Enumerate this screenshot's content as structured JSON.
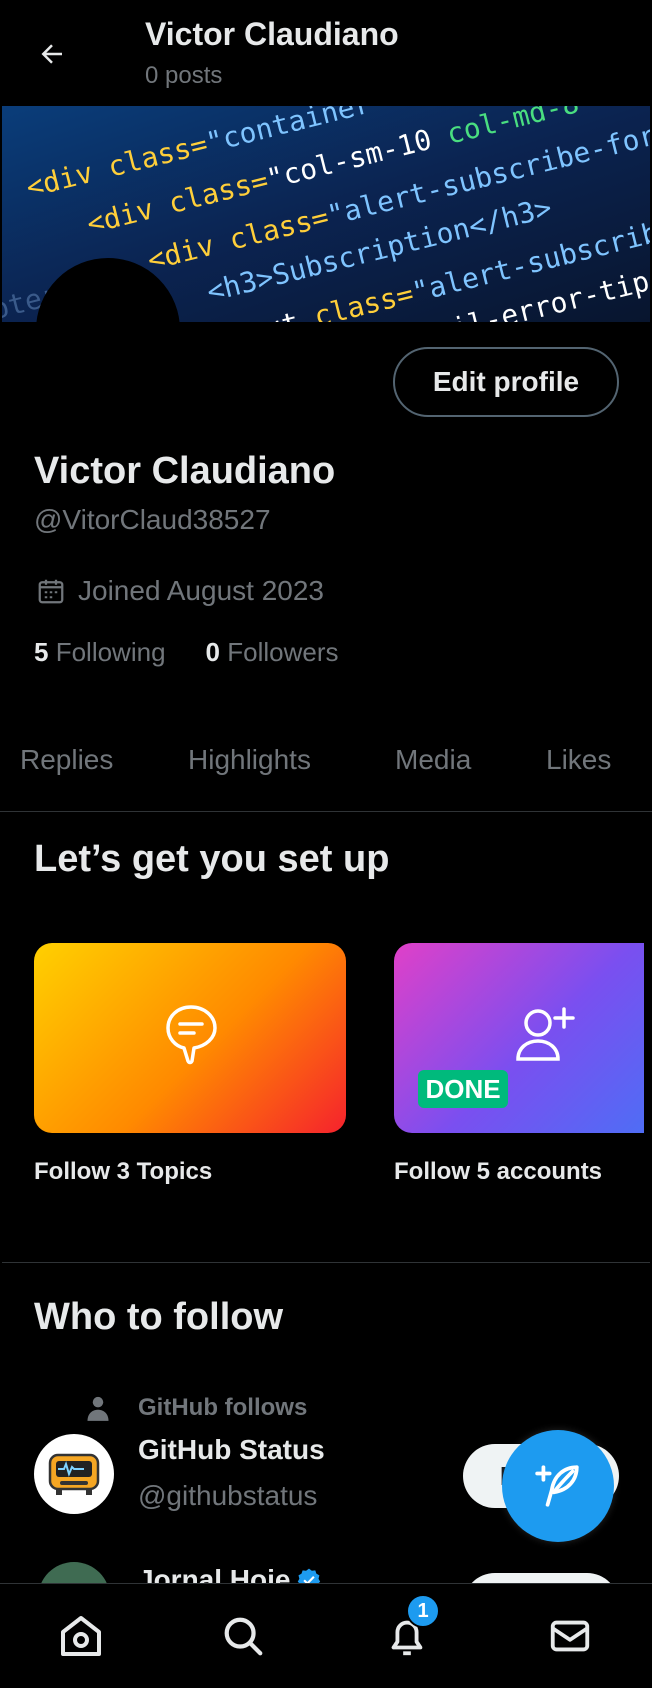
{
  "header": {
    "title": "Victor Claudiano",
    "post_count": "0 posts"
  },
  "profile": {
    "edit_button": "Edit profile",
    "display_name": "Victor Claudiano",
    "handle": "@VitorClaud38527",
    "joined": "Joined August 2023",
    "following_count": "5",
    "following_label": "Following",
    "followers_count": "0",
    "followers_label": "Followers"
  },
  "tabs": [
    "Replies",
    "Highlights",
    "Media",
    "Likes"
  ],
  "setup": {
    "title": "Let’s get you set up",
    "cards": [
      {
        "label": "Follow 3 Topics",
        "icon": "topic-bubble-icon",
        "done": false
      },
      {
        "label": "Follow 5 accounts",
        "icon": "person-add-icon",
        "done": true,
        "badge": "DONE"
      }
    ]
  },
  "who_to_follow": {
    "title": "Who to follow",
    "suggestions": [
      {
        "social_context": "GitHub follows",
        "name": "GitHub Status",
        "handle": "@githubstatus",
        "follow_label": "Follow"
      },
      {
        "name": "Jornal Hoje",
        "verified": true
      }
    ]
  },
  "bottom_nav": {
    "items": [
      "home-icon",
      "search-icon",
      "notifications-icon",
      "messages-icon"
    ],
    "notification_count": "1"
  },
  "colors": {
    "accent": "#1d9bf0",
    "done_badge": "#00ba7c",
    "secondary_text": "#71767b"
  }
}
